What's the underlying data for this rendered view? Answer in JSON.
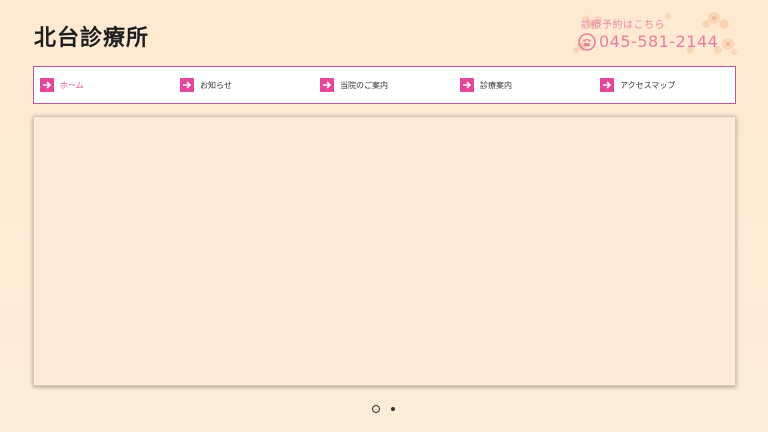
{
  "site": {
    "title": "北台診療所"
  },
  "contact": {
    "label": "診療予約はこちら",
    "phone": "045-581-2144"
  },
  "nav": {
    "items": [
      {
        "label": "ホーム",
        "active": true
      },
      {
        "label": "お知らせ",
        "active": false
      },
      {
        "label": "当院のご案内",
        "active": false
      },
      {
        "label": "診療案内",
        "active": false
      },
      {
        "label": "アクセスマップ",
        "active": false
      }
    ]
  },
  "slider": {
    "slide_count": 2,
    "current_slide": 1
  },
  "colors": {
    "accent": "#e5489a",
    "nav_border": "#b65a9a",
    "contact_text": "#e77ea1",
    "background": "#fdecd6"
  }
}
